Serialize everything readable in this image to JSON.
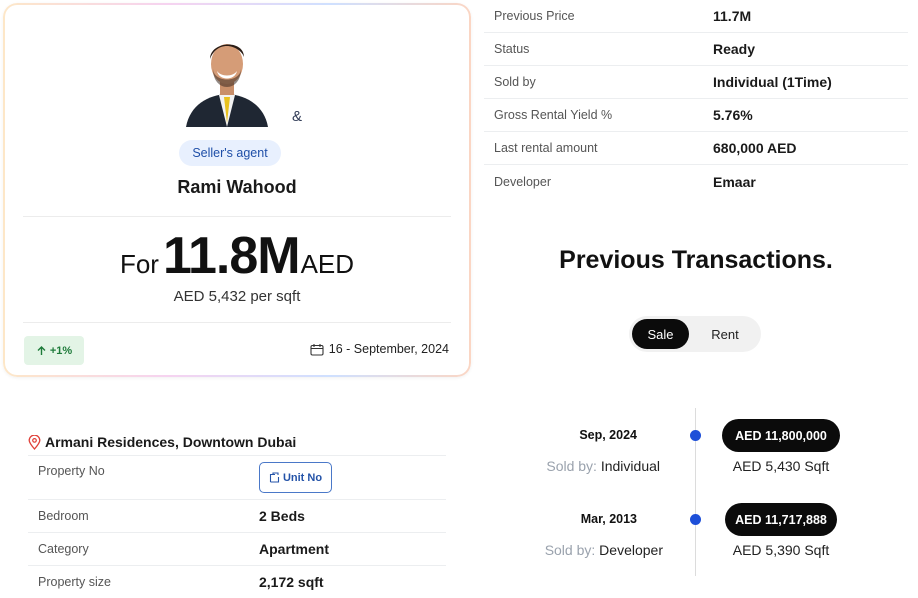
{
  "agent": {
    "role": "Seller's agent",
    "name": "Rami Wahood",
    "ampersand": "&",
    "price_prefix": "For",
    "price_value": "11.8M",
    "price_currency": "AED",
    "per_sqft": "AED 5,432 per sqft",
    "change": "+1%",
    "date": "16 - September, 2024"
  },
  "details": [
    {
      "label": "Previous Price",
      "value": "11.7M"
    },
    {
      "label": "Status",
      "value": "Ready"
    },
    {
      "label": "Sold by",
      "value": "Individual (1Time)"
    },
    {
      "label": "Gross Rental Yield %",
      "value": "5.76%"
    },
    {
      "label": "Last rental amount",
      "value": "680,000 AED"
    },
    {
      "label": "Developer",
      "value": "Emaar"
    }
  ],
  "transactions": {
    "title": "Previous Transactions.",
    "tabs": [
      "Sale",
      "Rent"
    ],
    "selected_tab": "Sale",
    "items": [
      {
        "date": "Sep, 2024",
        "sold_label": "Sold by:",
        "sold_by": "Individual",
        "price": "AED 11,800,000",
        "sqft": "AED 5,430 Sqft"
      },
      {
        "date": "Mar, 2013",
        "sold_label": "Sold by:",
        "sold_by": "Developer",
        "price": "AED 11,717,888",
        "sqft": "AED 5,390 Sqft"
      }
    ]
  },
  "property": {
    "location": "Armani Residences, Downtown Dubai",
    "rows": [
      {
        "label": "Property No",
        "button": "Unit No"
      },
      {
        "label": "Bedroom",
        "value": "2 Beds"
      },
      {
        "label": "Category",
        "value": "Apartment"
      },
      {
        "label": "Property size",
        "value": "2,172 sqft"
      }
    ]
  },
  "colors": {
    "accent_blue": "#1d4fd8",
    "badge_bg": "#e8f0fe",
    "positive_bg": "#e3f4e6",
    "positive_text": "#1e7b3a"
  },
  "icons": [
    "calendar-icon",
    "arrow-up-icon",
    "location-pin-icon",
    "unit-icon"
  ]
}
